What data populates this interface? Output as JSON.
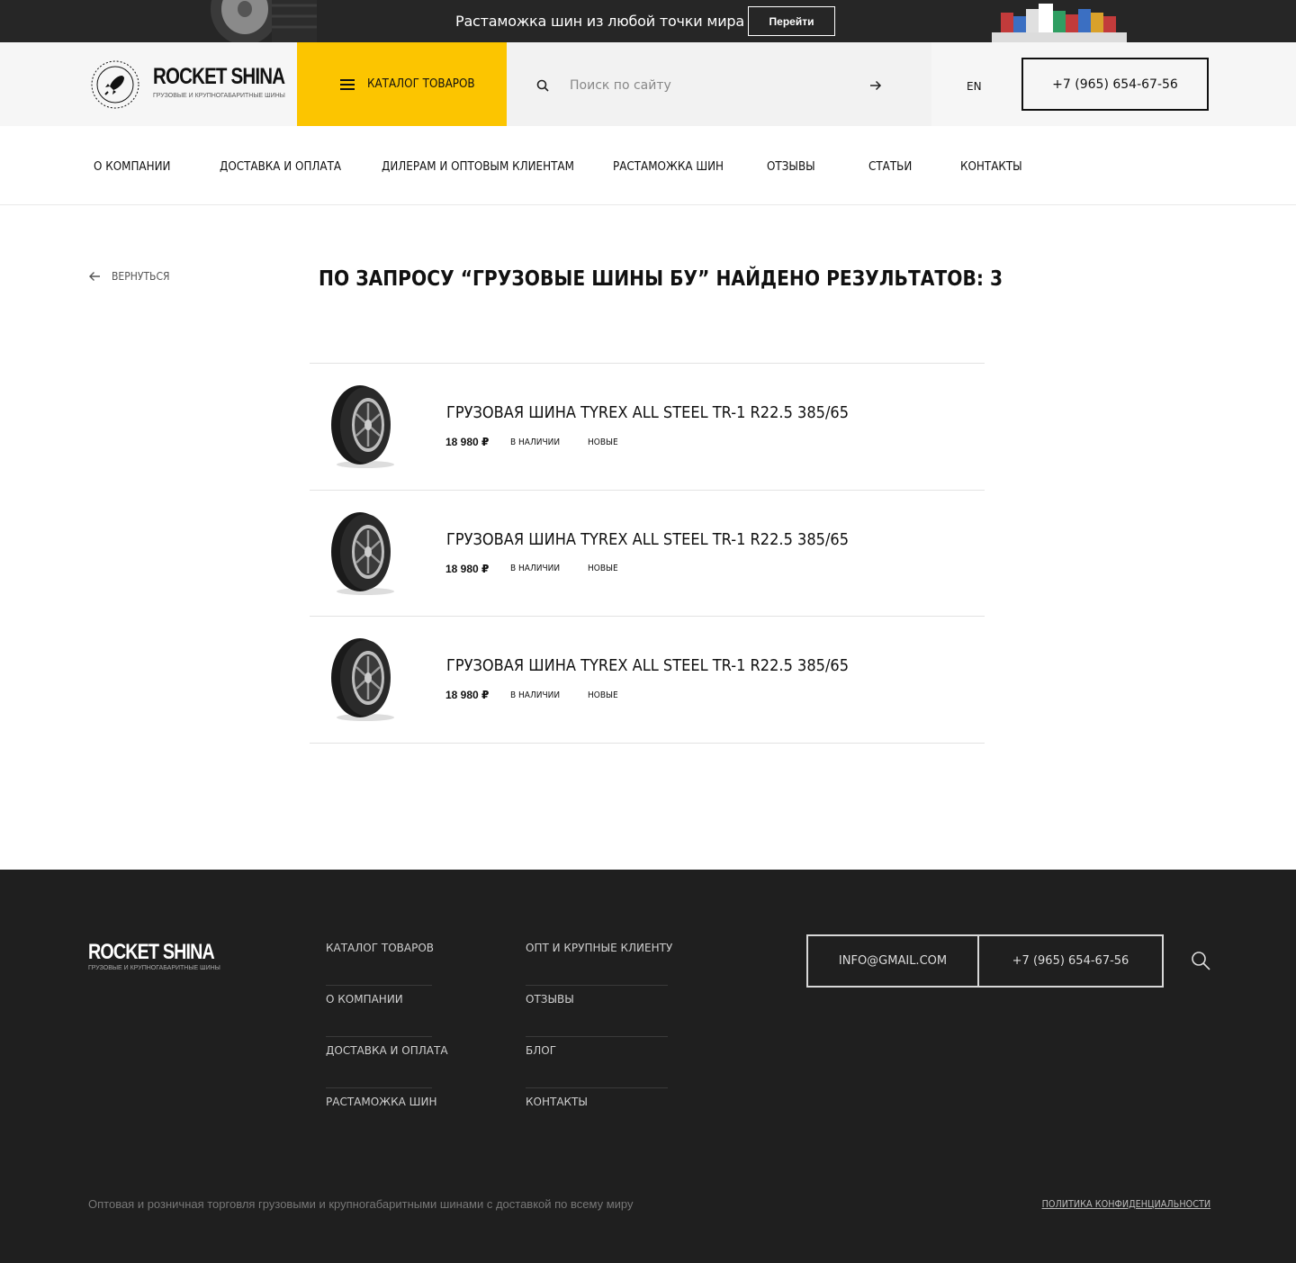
{
  "promo": {
    "text": "Растаможка шин из любой точки мира",
    "button_label": "Перейти"
  },
  "header": {
    "logo_name": "ROCKET SHINA",
    "logo_subtitle": "ГРУЗОВЫЕ И КРУПНОГАБАРИТНЫЕ ШИНЫ",
    "catalog_label": "Каталог товаров",
    "search_placeholder": "Поиск по сайту",
    "lang": "EN",
    "phone": "+7 (965) 654-67-56"
  },
  "nav": {
    "items": [
      {
        "label": "О компании"
      },
      {
        "label": "Доставка и оплата"
      },
      {
        "label": "Дилерам и оптовым клиентам"
      },
      {
        "label": "Растаможка шин"
      },
      {
        "label": "Отзывы"
      },
      {
        "label": "Статьи"
      },
      {
        "label": "Контакты"
      }
    ]
  },
  "main": {
    "back_label": "Вернуться",
    "title": "По запросу “грузовые шины бу” найдено результатов: 3",
    "results": [
      {
        "name": "Грузовая шина Tyrex All Steel TR-1 R22.5 385/65",
        "price": "18 980 ₽",
        "availability": "В наличии",
        "condition": "Новые"
      },
      {
        "name": "Грузовая шина Tyrex All Steel TR-1 R22.5 385/65",
        "price": "18 980 ₽",
        "availability": "В наличии",
        "condition": "Новые"
      },
      {
        "name": "Грузовая шина Tyrex All Steel TR-1 R22.5 385/65",
        "price": "18 980 ₽",
        "availability": "В наличии",
        "condition": "Новые"
      }
    ]
  },
  "footer": {
    "logo_name": "ROCKET SHINA",
    "logo_subtitle": "ГРУЗОВЫЕ И КРУПНОГАБАРИТНЫЕ ШИНЫ",
    "col1": [
      "Каталог товаров",
      "О компании",
      "Доставка и оплата",
      "Растаможка шин"
    ],
    "col2": [
      "Опт и крупные клиенту",
      "Отзывы",
      "Блог",
      "Контакты"
    ],
    "email": "info@gmail.com",
    "phone": "+7 (965) 654-67-56",
    "tagline": "Оптовая и розничная торговля грузовыми и крупногабаритными шинами с доставкой по всему миру",
    "policy": "Политика конфиденциальности"
  },
  "colors": {
    "accent": "#fcc500",
    "promo_bg": "#262626",
    "footer_bg": "#1f1f1f"
  },
  "icons": {
    "catalog": "burger-menu-icon",
    "search": "search-icon",
    "search_submit": "arrow-right-icon",
    "back": "arrow-left-icon",
    "logo": "rocket-icon"
  }
}
